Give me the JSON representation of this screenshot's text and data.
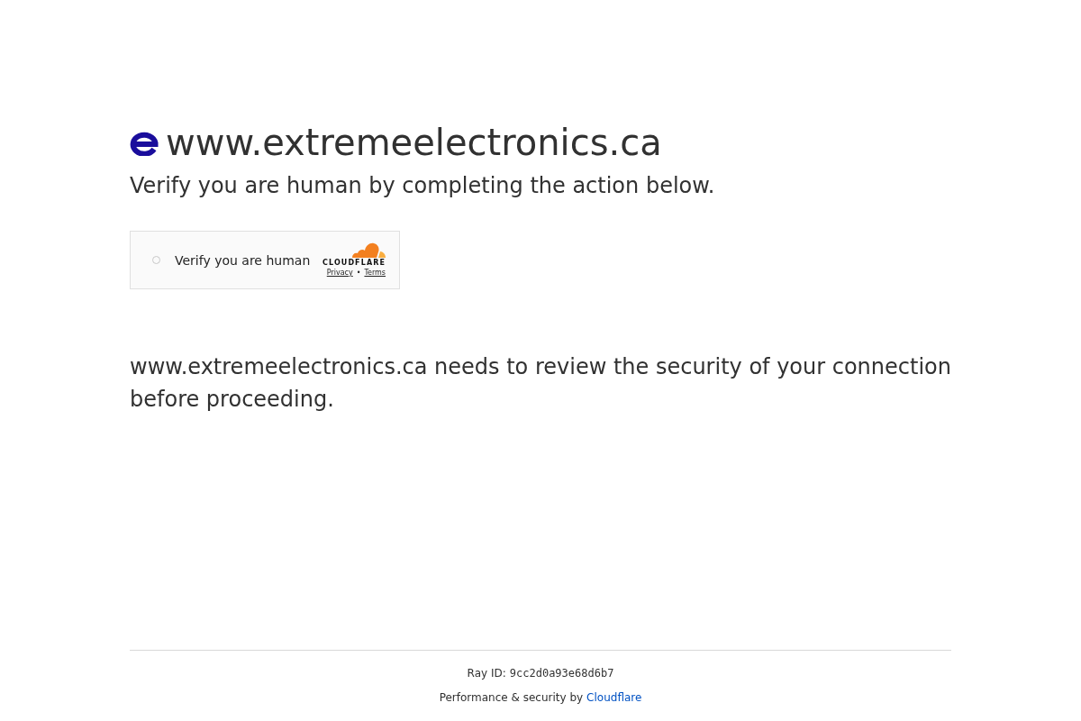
{
  "header": {
    "site": "www.extremeelectronics.ca",
    "subtitle": "Verify you are human by completing the action below."
  },
  "widget": {
    "checked": false,
    "label": "Verify you are human",
    "brand": "CLOUDFLARE",
    "links": [
      "Privacy",
      "Terms"
    ],
    "separator": "•"
  },
  "message": "www.extremeelectronics.ca needs to review the security of your connection before proceeding.",
  "footer": {
    "ray_id_label": "Ray ID:",
    "ray_id": "9cc2d0a93e68d6b7",
    "credit": "Performance & security by",
    "credit_link": "Cloudflare"
  }
}
